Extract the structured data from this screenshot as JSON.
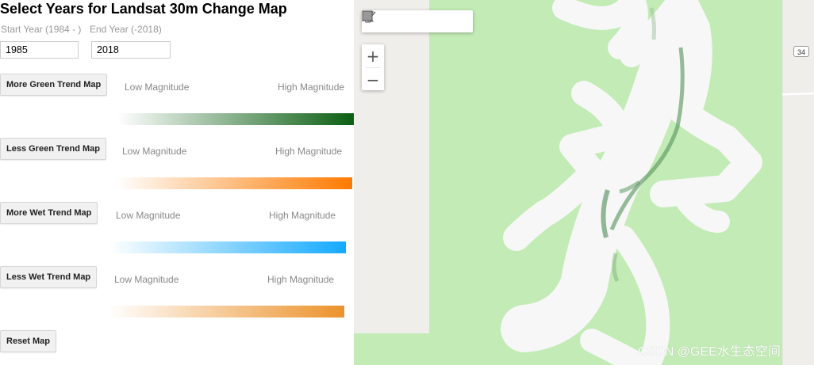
{
  "panel": {
    "title": "Select Years for Landsat 30m Change Map",
    "start_label": "Start Year (1984 - )",
    "end_label": "End Year (-2018)",
    "start_value": "1985",
    "end_value": "2018",
    "legends": [
      {
        "button": "More Green Trend Map",
        "low": "Low Magnitude",
        "high": "High Magnitude",
        "color_low": "#ffffff",
        "color_high": "#0b5e12"
      },
      {
        "button": "Less Green Trend Map",
        "low": "Low Magnitude",
        "high": "High Magnitude",
        "color_low": "#ffffff",
        "color_high": "#ff7a00"
      },
      {
        "button": "More Wet Trend Map",
        "low": "Low Magnitude",
        "high": "High Magnitude",
        "color_low": "#ffffff",
        "color_high": "#14a9ff"
      },
      {
        "button": "Less Wet Trend Map",
        "low": "Low Magnitude",
        "high": "High Magnitude",
        "color_low": "#ffffff",
        "color_high": "#ec922b"
      }
    ],
    "reset_button": "Reset Map"
  },
  "map": {
    "tools": [
      "hand-icon",
      "marker-icon",
      "line-icon",
      "polygon-icon",
      "rectangle-icon"
    ],
    "zoom_in": "+",
    "zoom_out": "−",
    "route_shield": "34",
    "background_color": "#f0eeea",
    "field_color": "#c2ebb5",
    "stream_color": "#f6f7f6",
    "watermark": "CSDN @GEE水生态空间"
  }
}
